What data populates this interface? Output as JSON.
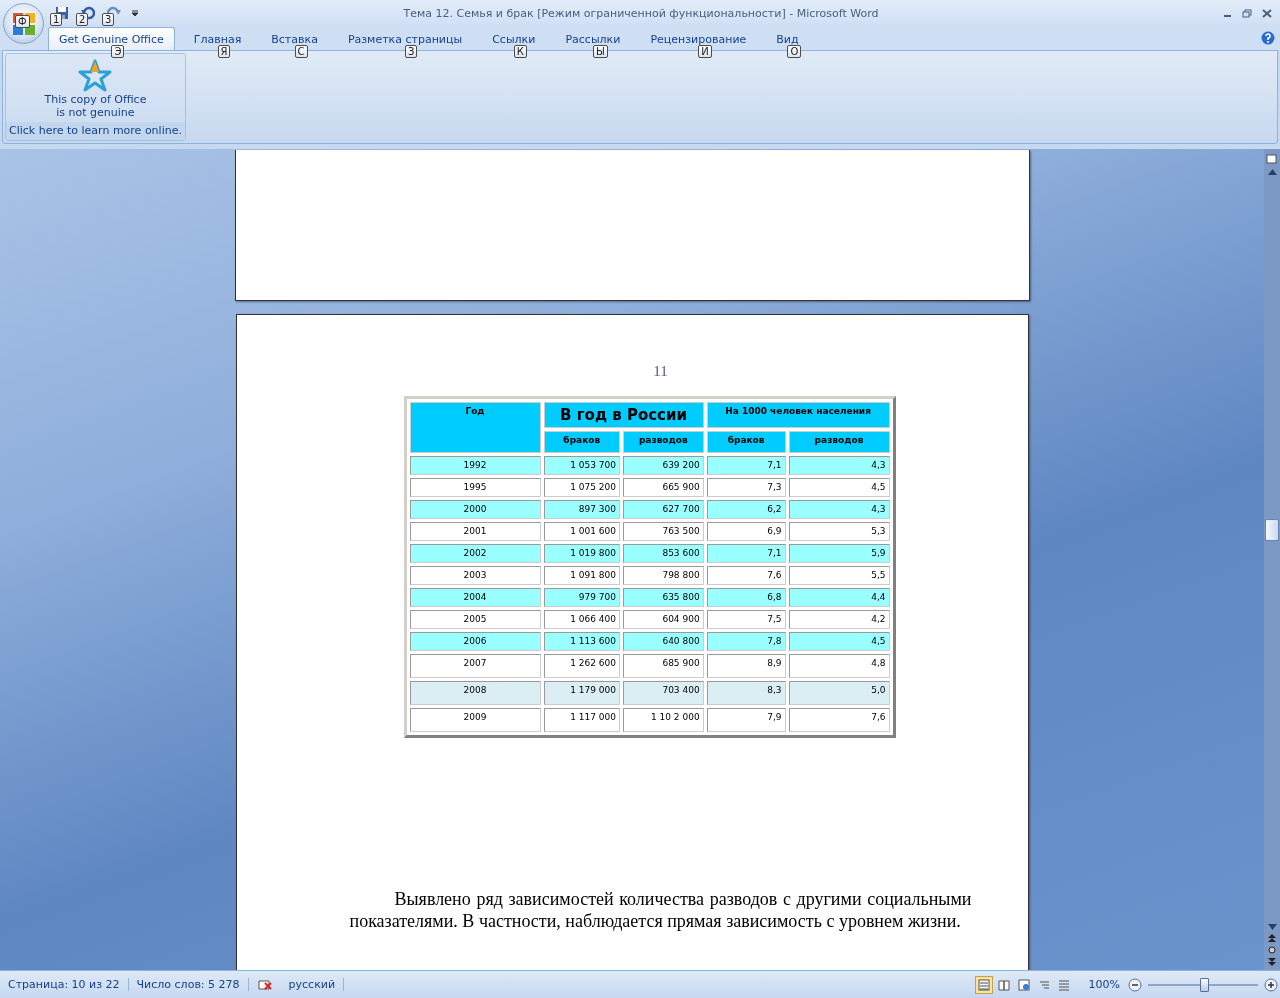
{
  "window": {
    "title": "Тема 12. Семья и брак [Режим ограниченной функциональности] - Microsoft Word",
    "office_key": "Ф"
  },
  "quick_access": [
    {
      "kind": "save",
      "key": "1"
    },
    {
      "kind": "undo",
      "key": "2"
    },
    {
      "kind": "redo",
      "key": "3"
    }
  ],
  "tabs": [
    {
      "label": "Get Genuine Office",
      "key": "Э",
      "selected": true
    },
    {
      "label": "Главная",
      "key": "Я",
      "selected": false
    },
    {
      "label": "Вставка",
      "key": "С",
      "selected": false
    },
    {
      "label": "Разметка страницы",
      "key": "З",
      "selected": false
    },
    {
      "label": "Ссылки",
      "key": "К",
      "selected": false
    },
    {
      "label": "Рассылки",
      "key": "Ы",
      "selected": false
    },
    {
      "label": "Рецензирование",
      "key": "И",
      "selected": false
    },
    {
      "label": "Вид",
      "key": "О",
      "selected": false
    }
  ],
  "ribbon": {
    "message_lines": [
      "This copy of Office",
      "is not genuine"
    ],
    "link": "Click here to learn more online."
  },
  "document": {
    "page_number": "11",
    "table": {
      "year_header": "Год",
      "group_headers": [
        "В год в России",
        "На 1000 человек населения"
      ],
      "subheaders": [
        "браков",
        "разводов",
        "браков",
        "разводов"
      ],
      "rows": [
        {
          "cells": [
            "1992",
            "1 053 700",
            "639 200",
            "7,1",
            "4,3"
          ],
          "color": "#99ffff"
        },
        {
          "cells": [
            "1995",
            "1 075 200",
            "665 900",
            "7,3",
            "4,5"
          ],
          "color": "#ffffff"
        },
        {
          "cells": [
            "2000",
            "897 300",
            "627 700",
            "6,2",
            "4,3"
          ],
          "color": "#99ffff"
        },
        {
          "cells": [
            "2001",
            "1 001 600",
            "763 500",
            "6,9",
            "5,3"
          ],
          "color": "#ffffff"
        },
        {
          "cells": [
            "2002",
            "1 019 800",
            "853 600",
            "7,1",
            "5,9"
          ],
          "color": "#99ffff"
        },
        {
          "cells": [
            "2003",
            "1 091 800",
            "798 800",
            "7,6",
            "5,5"
          ],
          "color": "#ffffff"
        },
        {
          "cells": [
            "2004",
            "979 700",
            "635 800",
            "6,8",
            "4,4"
          ],
          "color": "#99ffff"
        },
        {
          "cells": [
            "2005",
            "1 066 400",
            "604 900",
            "7,5",
            "4,2"
          ],
          "color": "#ffffff"
        },
        {
          "cells": [
            "2006",
            "1 113 600",
            "640 800",
            "7,8",
            "4,5"
          ],
          "color": "#99ffff"
        },
        {
          "cells": [
            "2007",
            "1 262 600",
            "685 900",
            "8,9",
            "4,8"
          ],
          "color": "#ffffff"
        },
        {
          "cells": [
            "2008",
            "1 179 000",
            "703 400",
            "8,3",
            "5,0"
          ],
          "color": "#daeef3"
        },
        {
          "cells": [
            "2009",
            "1 117 000",
            "1 10 2 000",
            "7,9",
            "7,6"
          ],
          "color": "#ffffff"
        }
      ]
    },
    "paragraph": "Выявлено ряд зависимостей количества разводов с другими социальными показателями. В частности, наблюдается прямая зависимость с уровнем жизни."
  },
  "status_bar": {
    "page": "Страница: 10 из 22",
    "words": "Число слов: 5 278",
    "language": "русский",
    "views": [
      {
        "kind": "print",
        "selected": true
      },
      {
        "kind": "reading",
        "selected": false
      },
      {
        "kind": "web",
        "selected": false
      },
      {
        "kind": "outline",
        "selected": false
      },
      {
        "kind": "draft",
        "selected": false
      }
    ],
    "zoom": "100%",
    "zoom_slider": {
      "level": 0.5
    }
  }
}
